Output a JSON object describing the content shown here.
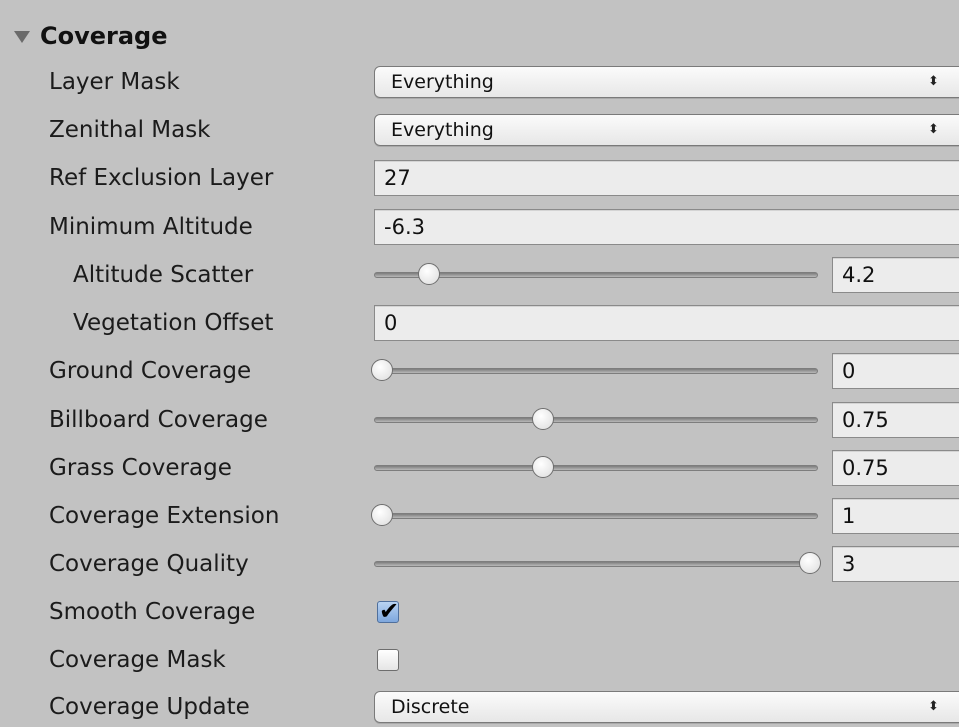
{
  "section": {
    "title": "Coverage",
    "foldout_icon": "triangle-down-icon",
    "expanded": true
  },
  "fields": {
    "layer_mask": {
      "label": "Layer Mask",
      "value": "Everything"
    },
    "zenithal_mask": {
      "label": "Zenithal Mask",
      "value": "Everything"
    },
    "ref_exclusion_layer": {
      "label": "Ref Exclusion Layer",
      "value": "27"
    },
    "minimum_altitude": {
      "label": "Minimum Altitude",
      "value": "-6.3"
    },
    "altitude_scatter": {
      "label": "Altitude Scatter",
      "value": "4.2",
      "fraction": 0.11
    },
    "vegetation_offset": {
      "label": "Vegetation Offset",
      "value": "0"
    },
    "ground_coverage": {
      "label": "Ground Coverage",
      "value": "0",
      "fraction": 0.0
    },
    "billboard_coverage": {
      "label": "Billboard Coverage",
      "value": "0.75",
      "fraction": 0.375
    },
    "grass_coverage": {
      "label": "Grass Coverage",
      "value": "0.75",
      "fraction": 0.375
    },
    "coverage_extension": {
      "label": "Coverage Extension",
      "value": "1",
      "fraction": 0.0
    },
    "coverage_quality": {
      "label": "Coverage Quality",
      "value": "3",
      "fraction": 1.0
    },
    "smooth_coverage": {
      "label": "Smooth Coverage",
      "checked": true,
      "check_glyph": "✔"
    },
    "coverage_mask": {
      "label": "Coverage Mask",
      "checked": false
    },
    "coverage_update": {
      "label": "Coverage Update",
      "value": "Discrete"
    }
  },
  "popup_arrows_glyph": "⬍",
  "colors": {
    "panel_bg": "#c2c2c2",
    "checkbox_checked": "#7ea7dd"
  }
}
